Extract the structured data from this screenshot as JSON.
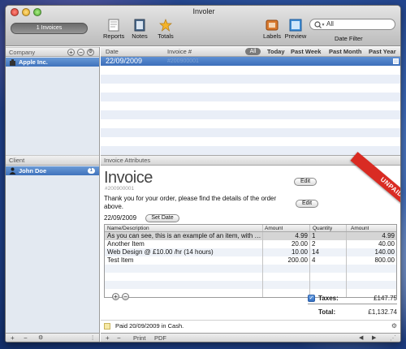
{
  "window": {
    "title": "Involer"
  },
  "toolbar": {
    "invoice_count_label": "1 Invoices",
    "buttons": [
      {
        "label": "Reports",
        "icon": "reports-icon"
      },
      {
        "label": "Notes",
        "icon": "notes-icon"
      },
      {
        "label": "Totals",
        "icon": "totals-star-icon"
      },
      {
        "label": "Labels",
        "icon": "labels-icon"
      },
      {
        "label": "Preview",
        "icon": "preview-icon"
      }
    ],
    "search_placeholder": "All",
    "date_filter_label": "Date Filter"
  },
  "company_pane": {
    "header": "Company",
    "selected_company": "Apple Inc."
  },
  "client_pane": {
    "header": "Client",
    "selected_client": "John Doe",
    "badge_count": "1"
  },
  "invoice_list": {
    "columns": [
      "Date",
      "Invoice #"
    ],
    "filters": [
      "All",
      "Today",
      "Past Week",
      "Past Month",
      "Past Year"
    ],
    "rows": [
      {
        "date": "22/09/2009",
        "invoice_no": "#200900001"
      }
    ]
  },
  "attributes": {
    "header": "Invoice Attributes",
    "title": "Invoice",
    "number": "#200900001",
    "message": "Thank you for your order, please find the details of the order above.",
    "date": "22/09/2009",
    "set_date_label": "Set Date",
    "edit_label": "Edit",
    "status_ribbon": "UNPAID"
  },
  "items_table": {
    "columns": [
      "Name/Description",
      "Amount",
      "Quantity",
      "Amount"
    ],
    "rows": [
      {
        "name": "As you can see, this is an example of an item, with …",
        "amount": "4.99",
        "qty": "1",
        "total": "4.99"
      },
      {
        "name": "Another Item",
        "amount": "20.00",
        "qty": "2",
        "total": "40.00"
      },
      {
        "name": "Web Design @ £10.00 /hr (14 hours)",
        "amount": "10.00",
        "qty": "14",
        "total": "140.00"
      },
      {
        "name": "Test Item",
        "amount": "200.00",
        "qty": "4",
        "total": "800.00"
      }
    ]
  },
  "totals": {
    "taxes_label": "Taxes:",
    "taxes_value": "£147.75",
    "total_label": "Total:",
    "total_value": "£1,132.74"
  },
  "note": {
    "text": "Paid 20/09/2009 in Cash."
  },
  "bottom_bar": {
    "print_label": "Print",
    "pdf_label": "PDF"
  },
  "colors": {
    "selection_blue": "#3f72bc",
    "ribbon_red": "#d92b23",
    "stripe_blue": "#eef2f8"
  }
}
